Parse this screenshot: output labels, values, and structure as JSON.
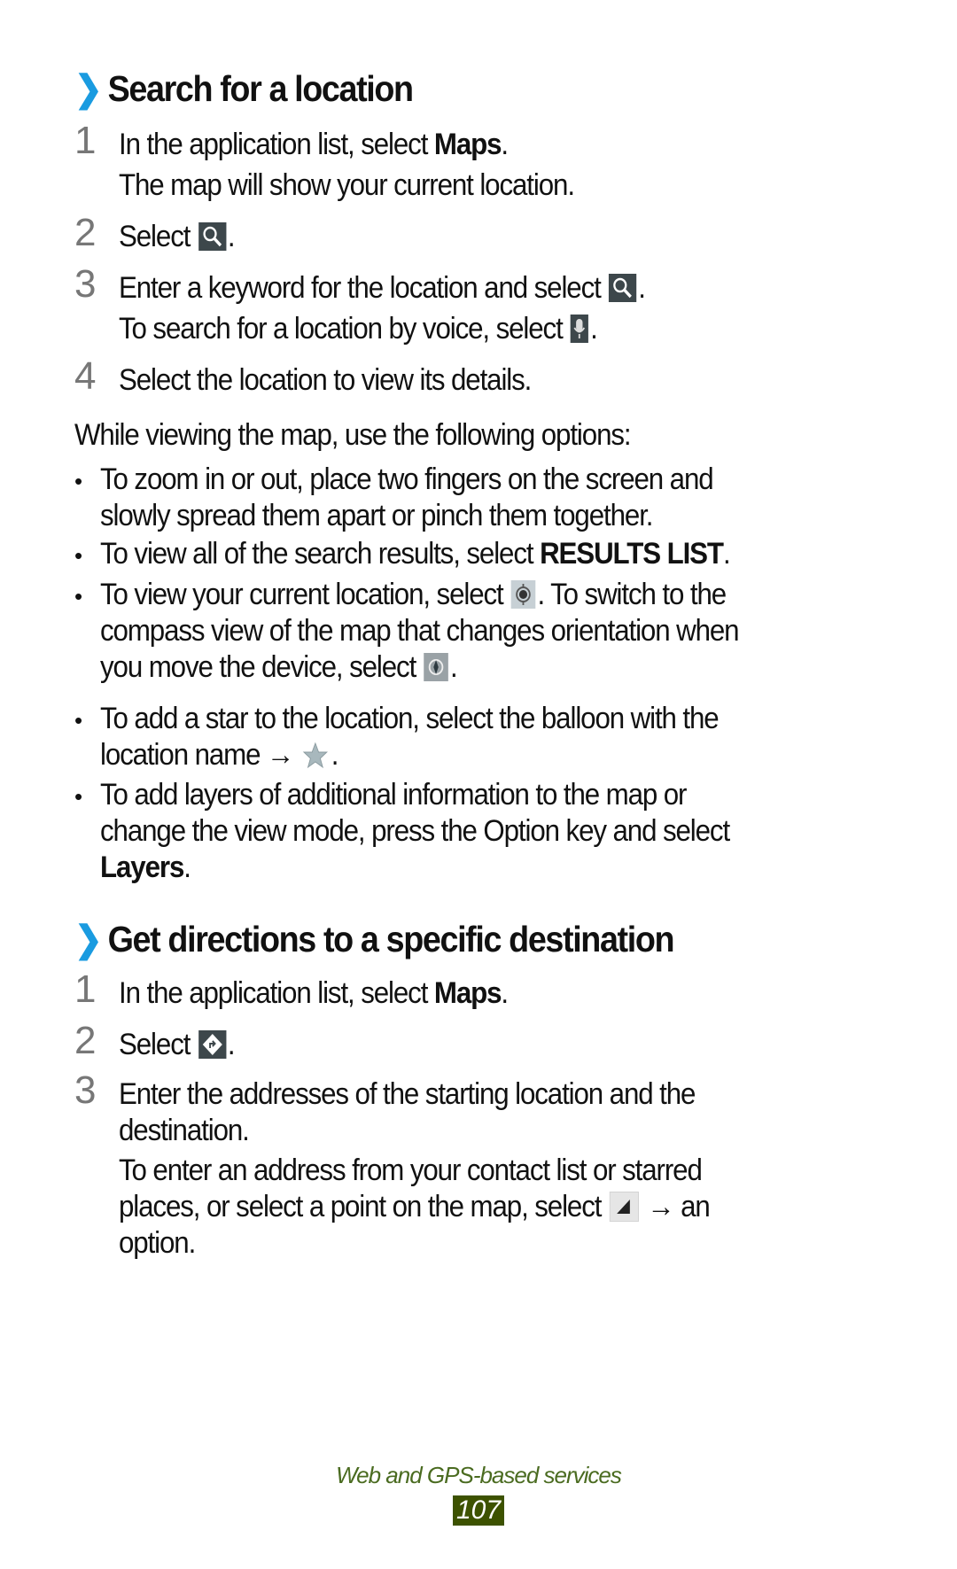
{
  "section1": {
    "chevron": "❯",
    "title": "Search for a location",
    "steps": [
      {
        "num": "1",
        "pre": "In the application list, select ",
        "bold": "Maps",
        "post": ".",
        "note": "The map will show your current location."
      },
      {
        "num": "2",
        "pre": "Select ",
        "icon": "search-icon",
        "post": "."
      },
      {
        "num": "3",
        "pre": "Enter a keyword for the location and select ",
        "icon": "search-icon",
        "post": ".",
        "note_pre": "To search for a location by voice, select ",
        "note_icon": "microphone-icon",
        "note_post": "."
      },
      {
        "num": "4",
        "text": "Select the location to view its details."
      }
    ],
    "intro": "While viewing the map, use the following options:",
    "bullets": [
      {
        "l1": "To zoom in or out, place two fingers on the screen and",
        "l2": "slowly spread them apart or pinch them together."
      },
      {
        "pre": "To view all of the search results, select ",
        "bold": "RESULTS LIST",
        "post": "."
      },
      {
        "l1_pre": "To view your current location, select ",
        "l1_icon": "my-location-icon",
        "l1_post": ". To switch to the",
        "l2": "compass view of the map that changes orientation when",
        "l3_pre": "you move the device, select ",
        "l3_icon": "compass-icon",
        "l3_post": "."
      },
      {
        "l1": "To add a star to the location, select the balloon with the",
        "l2_pre": "location name → ",
        "l2_icon": "star-icon",
        "l2_post": "."
      },
      {
        "l1": "To add layers of additional information to the map or",
        "l2": "change the view mode, press the Option key and select",
        "l3_bold": "Layers",
        "l3_post": "."
      }
    ]
  },
  "section2": {
    "chevron": "❯",
    "title": "Get directions to a specific destination",
    "steps": [
      {
        "num": "1",
        "pre": "In the application list, select ",
        "bold": "Maps",
        "post": "."
      },
      {
        "num": "2",
        "pre": "Select ",
        "icon": "directions-icon",
        "post": "."
      },
      {
        "num": "3",
        "l1": "Enter the addresses of the starting location and the",
        "l2": "destination.",
        "n1": "To enter an address from your contact list or starred",
        "n2_pre": "places, or select a point on the map, select ",
        "n2_icon": "dropdown-triangle-icon",
        "n2_post": " → an",
        "n3": "option."
      }
    ]
  },
  "footer": {
    "chapter": "Web and GPS-based services",
    "page": "107"
  }
}
